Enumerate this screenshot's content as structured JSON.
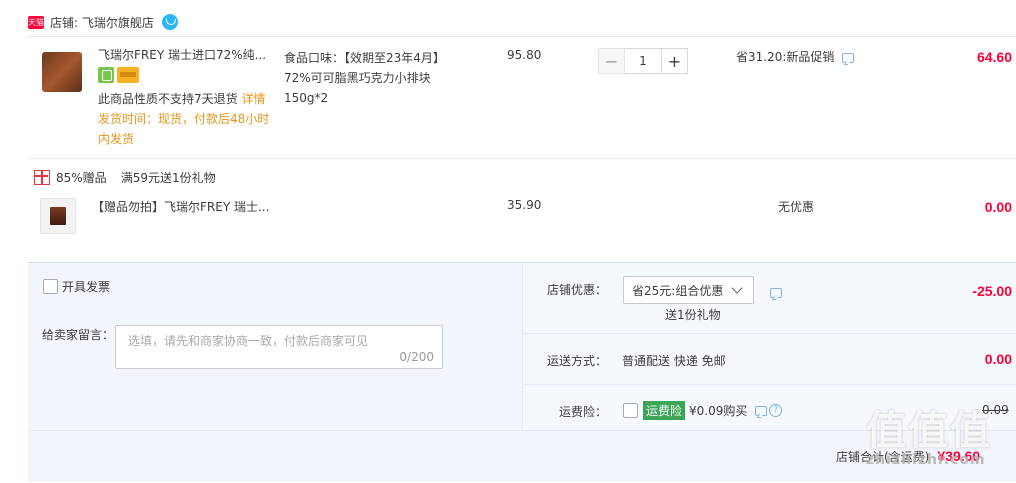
{
  "store": {
    "badge": "天猫",
    "label": "店铺: 飞瑞尔旗舰店"
  },
  "item": {
    "title": "飞瑞尔FREY 瑞士进口72%纯...",
    "spec": "食品口味：【效期至23年4月】72%可可脂黑巧克力小排块150g*2",
    "no_return": "此商品性质不支持7天退货",
    "details_link": "详情",
    "ship_time": "发货时间：现货，付款后48小时内发货",
    "unit_price": "95.80",
    "quantity": "1",
    "promo": "省31.20:新品促销",
    "subtotal": "64.60"
  },
  "gift_promo": {
    "tag": "85%赠品",
    "text": "满59元送1份礼物"
  },
  "gift_item": {
    "title": "【赠品勿拍】飞瑞尔FREY 瑞士...",
    "unit_price": "35.90",
    "promo": "无优惠",
    "subtotal": "0.00"
  },
  "order_options": {
    "invoice_label": "开具发票",
    "message_label": "给卖家留言：",
    "message_placeholder": "选填，请先和商家协商一致，付款后商家可见",
    "message_count": "0/200",
    "store_discount_label": "店铺优惠：",
    "store_discount_value": "省25元:组合优惠",
    "store_discount_note": "送1份礼物",
    "store_discount_amount": "-25.00",
    "shipping_label": "运送方式：",
    "shipping_value": "普通配送 快递 免邮",
    "shipping_amount": "0.00",
    "insurance_label": "运费险：",
    "insurance_tag": "运费险",
    "insurance_price": "¥0.09购买",
    "insurance_amount": "0.09",
    "store_total_label": "店铺合计(含运费)",
    "store_total_value": "¥39.60"
  },
  "watermark": {
    "main": "值值值",
    "sub": "zhizhizhi.com"
  }
}
